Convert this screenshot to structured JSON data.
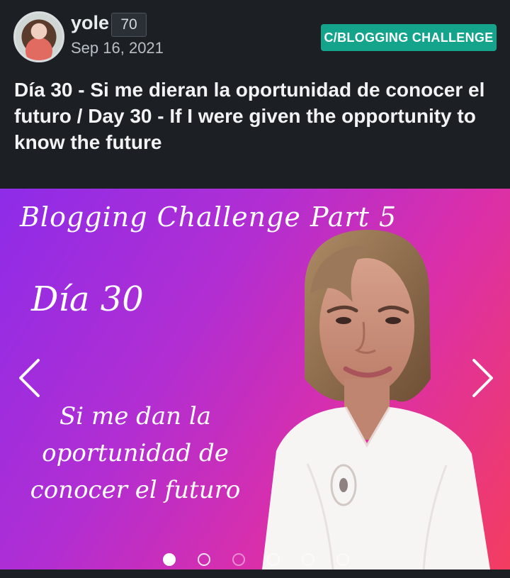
{
  "post": {
    "username": "yole",
    "reputation": "70",
    "date": "Sep 16, 2021",
    "community": "C/BLOGGING CHALLENGE",
    "title": "Día 30 - Si me dieran la oportunidad de conocer el futuro / Day 30 - If I were given the opportunity to know the future"
  },
  "slide": {
    "headline": "Blogging Challenge Part 5",
    "day": "Día 30",
    "subtitle": "Si me dan la oportunidad de conocer el futuro"
  },
  "carousel": {
    "slide_count": 6,
    "active_index": 0
  },
  "colors": {
    "background": "#1c2024",
    "community_badge": "#14a38b",
    "gradient_start": "#8e2ce8",
    "gradient_end": "#f33d60"
  },
  "icons": {
    "previous": "chevron-left-icon",
    "next": "chevron-right-icon"
  }
}
